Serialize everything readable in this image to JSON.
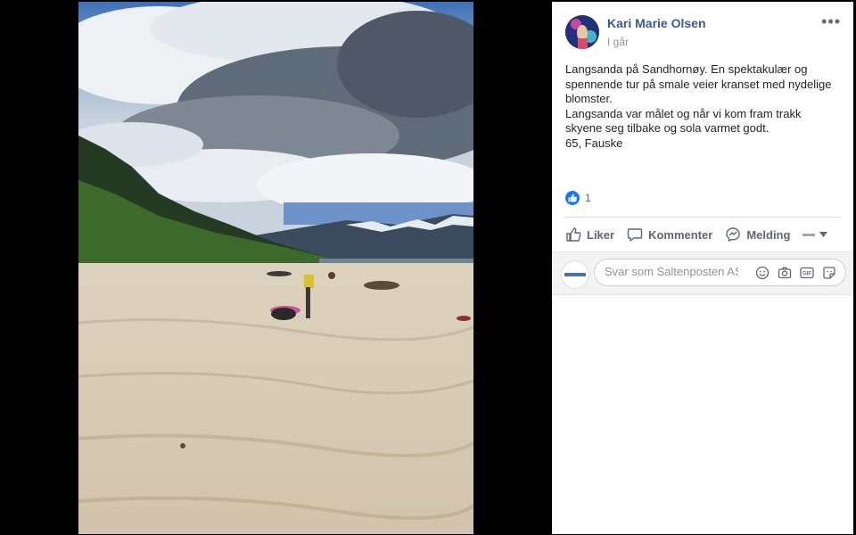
{
  "post": {
    "author": "Kari Marie Olsen",
    "time": "I går",
    "text_lines": [
      "Langsanda på Sandhornøy. En spektakulær og",
      "spennende tur på smale veier kranset med nydelige",
      "blomster.",
      "Langsanda var målet og når vi kom fram trakk",
      "skyene seg tilbake og sola varmet godt.",
      "65, Fauske"
    ],
    "reaction_count": "1"
  },
  "actions": {
    "like": "Liker",
    "comment": "Kommenter",
    "message": "Melding"
  },
  "comment_box": {
    "placeholder": "Svar som Saltenposten AS"
  },
  "icons": {
    "more": "more-options-icon",
    "like": "thumbs-up-icon",
    "comment": "comment-icon",
    "message": "messenger-icon",
    "emoji": "emoji-icon",
    "camera": "camera-icon",
    "gif": "gif-icon",
    "sticker": "sticker-icon"
  },
  "colors": {
    "author_link": "#385898",
    "like_blue": "#1877f2",
    "action_gray": "#606770"
  }
}
